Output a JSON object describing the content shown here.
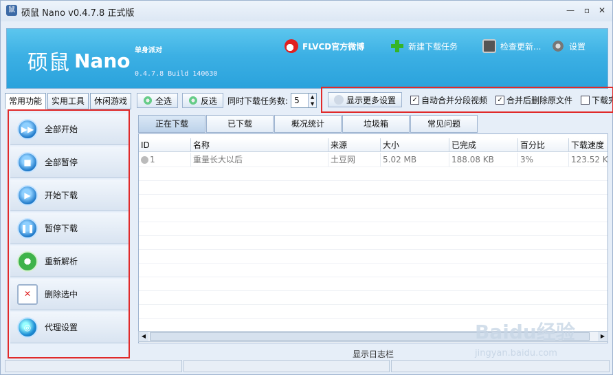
{
  "window": {
    "title": "硕鼠 Nano v0.4.7.8 正式版",
    "min_label": "—",
    "max_label": "▫",
    "close_label": "✕"
  },
  "banner": {
    "logo_cn": "硕鼠",
    "logo_en": "Nano",
    "tagline": "单身派对",
    "version": "0.4.7.8 Build 140630",
    "weibo": "FLVCD官方微博",
    "new_task": "新建下载任务",
    "check_update": "检查更新...",
    "settings": "设置"
  },
  "category_tabs": [
    "常用功能",
    "实用工具",
    "休闲游戏"
  ],
  "sidebar": {
    "items": [
      {
        "label": "全部开始",
        "icon": "▶▶"
      },
      {
        "label": "全部暂停",
        "icon": "■"
      },
      {
        "label": "开始下载",
        "icon": "▶"
      },
      {
        "label": "暂停下载",
        "icon": "❚❚"
      },
      {
        "label": "重新解析",
        "icon": "⟳"
      },
      {
        "label": "删除选中",
        "icon": "✕"
      },
      {
        "label": "代理设置",
        "icon": "◎"
      }
    ]
  },
  "toolbar": {
    "select_all": "全选",
    "invert": "反选",
    "concurrent_label": "同时下载任务数:",
    "concurrent_value": "5"
  },
  "options": {
    "show_more": "显示更多设置",
    "auto_merge": "自动合并分段视频",
    "delete_after_merge": "合并后删除原文件",
    "after_download": "下载完"
  },
  "tabs": [
    "正在下载",
    "已下载",
    "概况统计",
    "垃圾箱",
    "常见问题"
  ],
  "table": {
    "columns": [
      "ID",
      "名称",
      "来源",
      "大小",
      "已完成",
      "百分比",
      "下载速度"
    ],
    "rows": [
      [
        "1",
        "重量长大以后",
        "土豆网",
        "5.02 MB",
        "188.08 KB",
        "3%",
        "123.52 K"
      ]
    ]
  },
  "log_label": "显示日志栏",
  "watermark": {
    "text": "Baidu经验",
    "sub": "jingyan.baidu.com"
  }
}
